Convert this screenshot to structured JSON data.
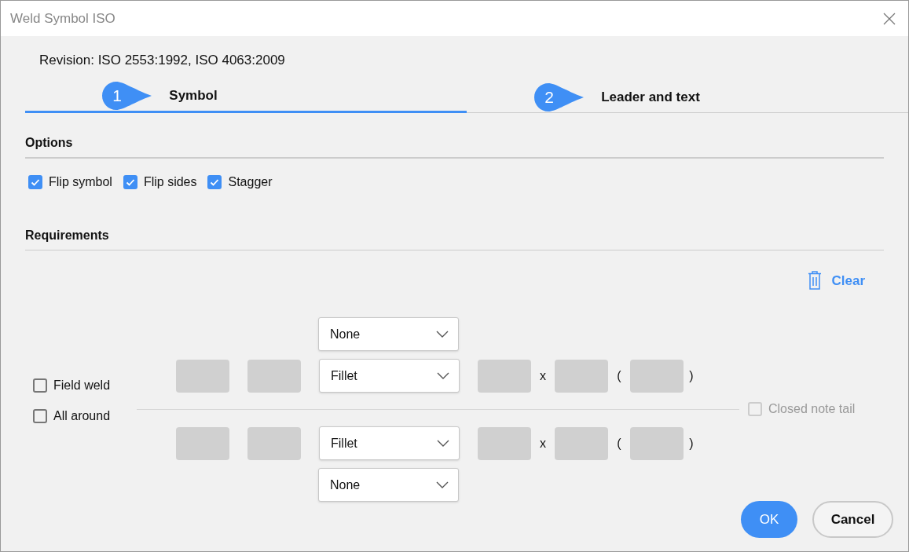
{
  "window": {
    "title": "Weld Symbol ISO"
  },
  "revision": "Revision: ISO 2553:1992, ISO 4063:2009",
  "tabs": [
    {
      "number": "1",
      "label": "Symbol",
      "selected": true
    },
    {
      "number": "2",
      "label": "Leader and text",
      "selected": false
    }
  ],
  "options": {
    "heading": "Options",
    "checkboxes": [
      {
        "label": "Flip symbol",
        "checked": true
      },
      {
        "label": "Flip sides",
        "checked": true
      },
      {
        "label": "Stagger",
        "checked": true
      }
    ]
  },
  "requirements": {
    "heading": "Requirements",
    "clear_button": "Clear",
    "checkboxes": [
      {
        "label": "Field weld",
        "checked": false
      },
      {
        "label": "All around",
        "checked": false
      }
    ],
    "sides": [
      {
        "supplementary": "None",
        "weld_type": "Fillet",
        "times": "x",
        "open_paren": "(",
        "close_paren": ")"
      },
      {
        "supplementary": "None",
        "weld_type": "Fillet",
        "times": "x",
        "open_paren": "(",
        "close_paren": ")"
      }
    ],
    "closed_note_tail": {
      "label": "Closed note tail",
      "checked": false,
      "disabled": true
    }
  },
  "buttons": [
    {
      "label": "OK",
      "primary": true
    },
    {
      "label": "Cancel",
      "primary": false
    }
  ]
}
